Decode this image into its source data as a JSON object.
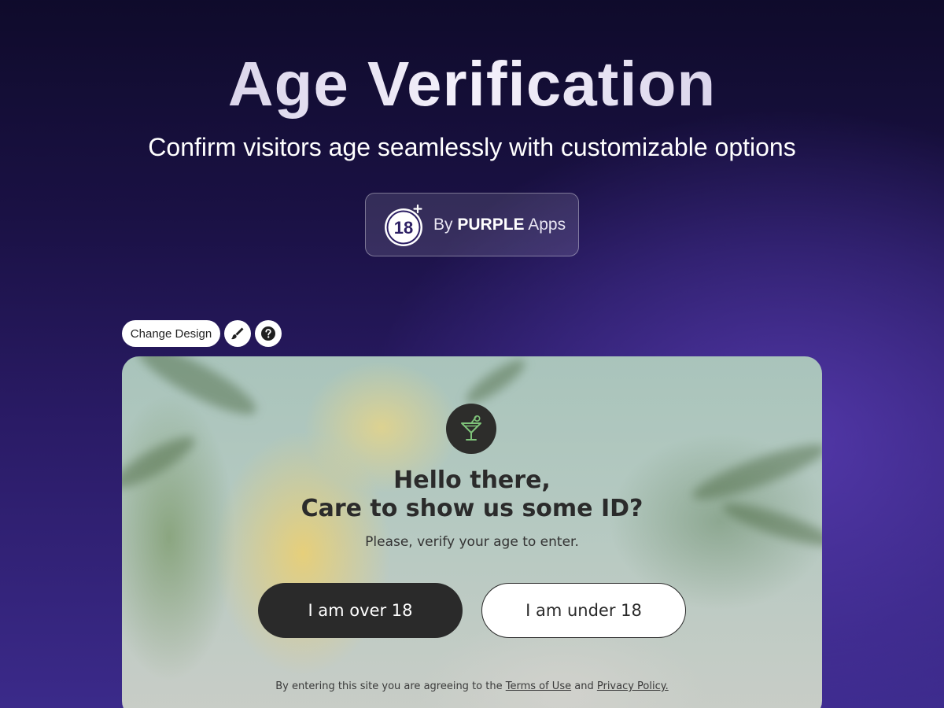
{
  "hero": {
    "title": "Age Verification",
    "subtitle": "Confirm visitors age seamlessly with customizable options"
  },
  "vendor_badge": {
    "icon_number": "18",
    "icon_name": "age-18-plus-icon",
    "prefix": "By",
    "brand": "PURPLE",
    "suffix": "Apps"
  },
  "toolbar": {
    "change_design_label": "Change Design",
    "edit_icon": "paintbrush-icon",
    "help_icon": "question-icon"
  },
  "popup": {
    "icon": "cocktail-icon",
    "heading_line1": "Hello there,",
    "heading_line2": "Care to show us some ID?",
    "subtext": "Please, verify your age to enter.",
    "over_button_label": "I am over 18",
    "under_button_label": "I am under 18",
    "legal_prefix": "By entering this site you are agreeing to the",
    "terms_link": "Terms of Use",
    "legal_and": "and",
    "privacy_link": "Privacy Policy."
  },
  "colors": {
    "background_dark": "#0f0b2b",
    "background_purple": "#3b2a8a",
    "primary_button": "#2a2a2a",
    "icon_green": "#7fc37a"
  }
}
